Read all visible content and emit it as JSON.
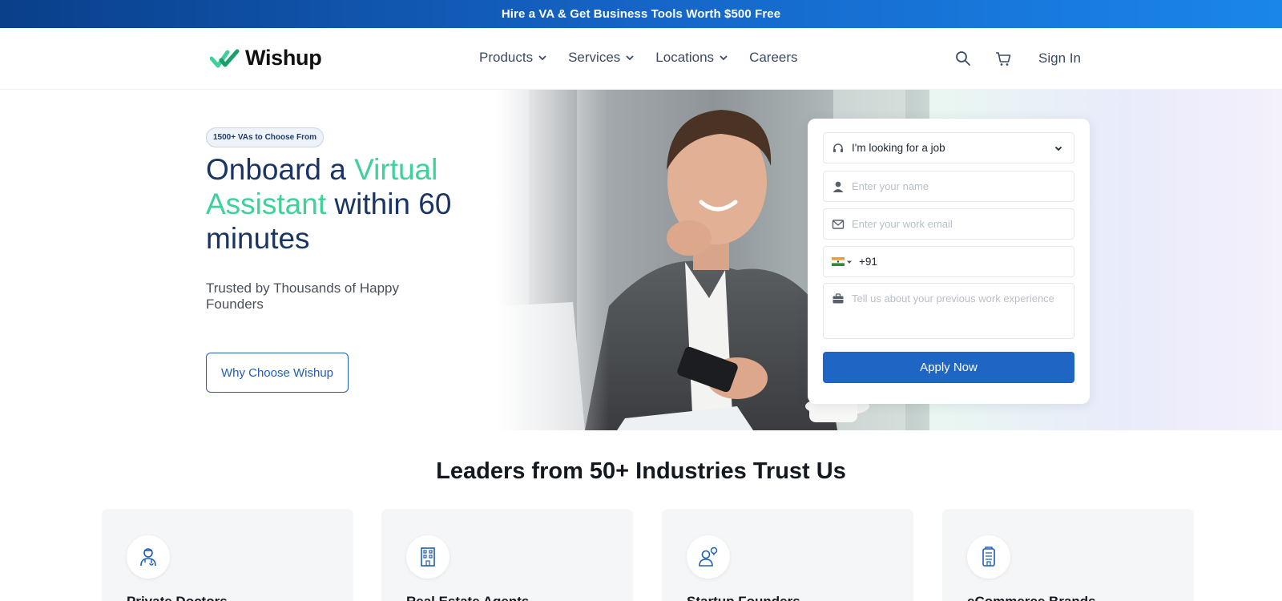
{
  "promo": {
    "text": "Hire a VA & Get Business Tools Worth $500 Free"
  },
  "header": {
    "logo_text": "Wishup",
    "nav": [
      {
        "label": "Products",
        "has_dropdown": true
      },
      {
        "label": "Services",
        "has_dropdown": true
      },
      {
        "label": "Locations",
        "has_dropdown": true
      },
      {
        "label": "Careers",
        "has_dropdown": false
      }
    ],
    "icons": [
      "search-icon",
      "cart-icon"
    ],
    "signin_label": "Sign In"
  },
  "hero": {
    "badge": "1500+ VAs to Choose From",
    "headline_part1": "Onboard a ",
    "headline_highlight": "Virtual Assistant",
    "headline_part2": " within 60 minutes",
    "subtitle": "Trusted by Thousands of Happy Founders",
    "cta_label": "Why Choose Wishup"
  },
  "form": {
    "role_select": {
      "value": "I'm looking for a job"
    },
    "name_placeholder": "Enter your name",
    "email_placeholder": "Enter your work email",
    "phone": {
      "country_code": "+91",
      "flag": "india-flag-icon"
    },
    "experience_placeholder": "Tell us about your previous work experience",
    "submit_label": "Apply Now"
  },
  "industries": {
    "title": "Leaders from 50+ Industries Trust Us",
    "cards": [
      {
        "label": "Private Doctors",
        "icon": "doctor-icon"
      },
      {
        "label": "Real Estate Agents",
        "icon": "building-icon"
      },
      {
        "label": "Startup Founders",
        "icon": "founder-icon"
      },
      {
        "label": "eCommerce Brands",
        "icon": "store-icon"
      }
    ]
  },
  "colors": {
    "brand_blue": "#1f66c4",
    "brand_green": "#3fd19a",
    "navy": "#1a3564"
  }
}
